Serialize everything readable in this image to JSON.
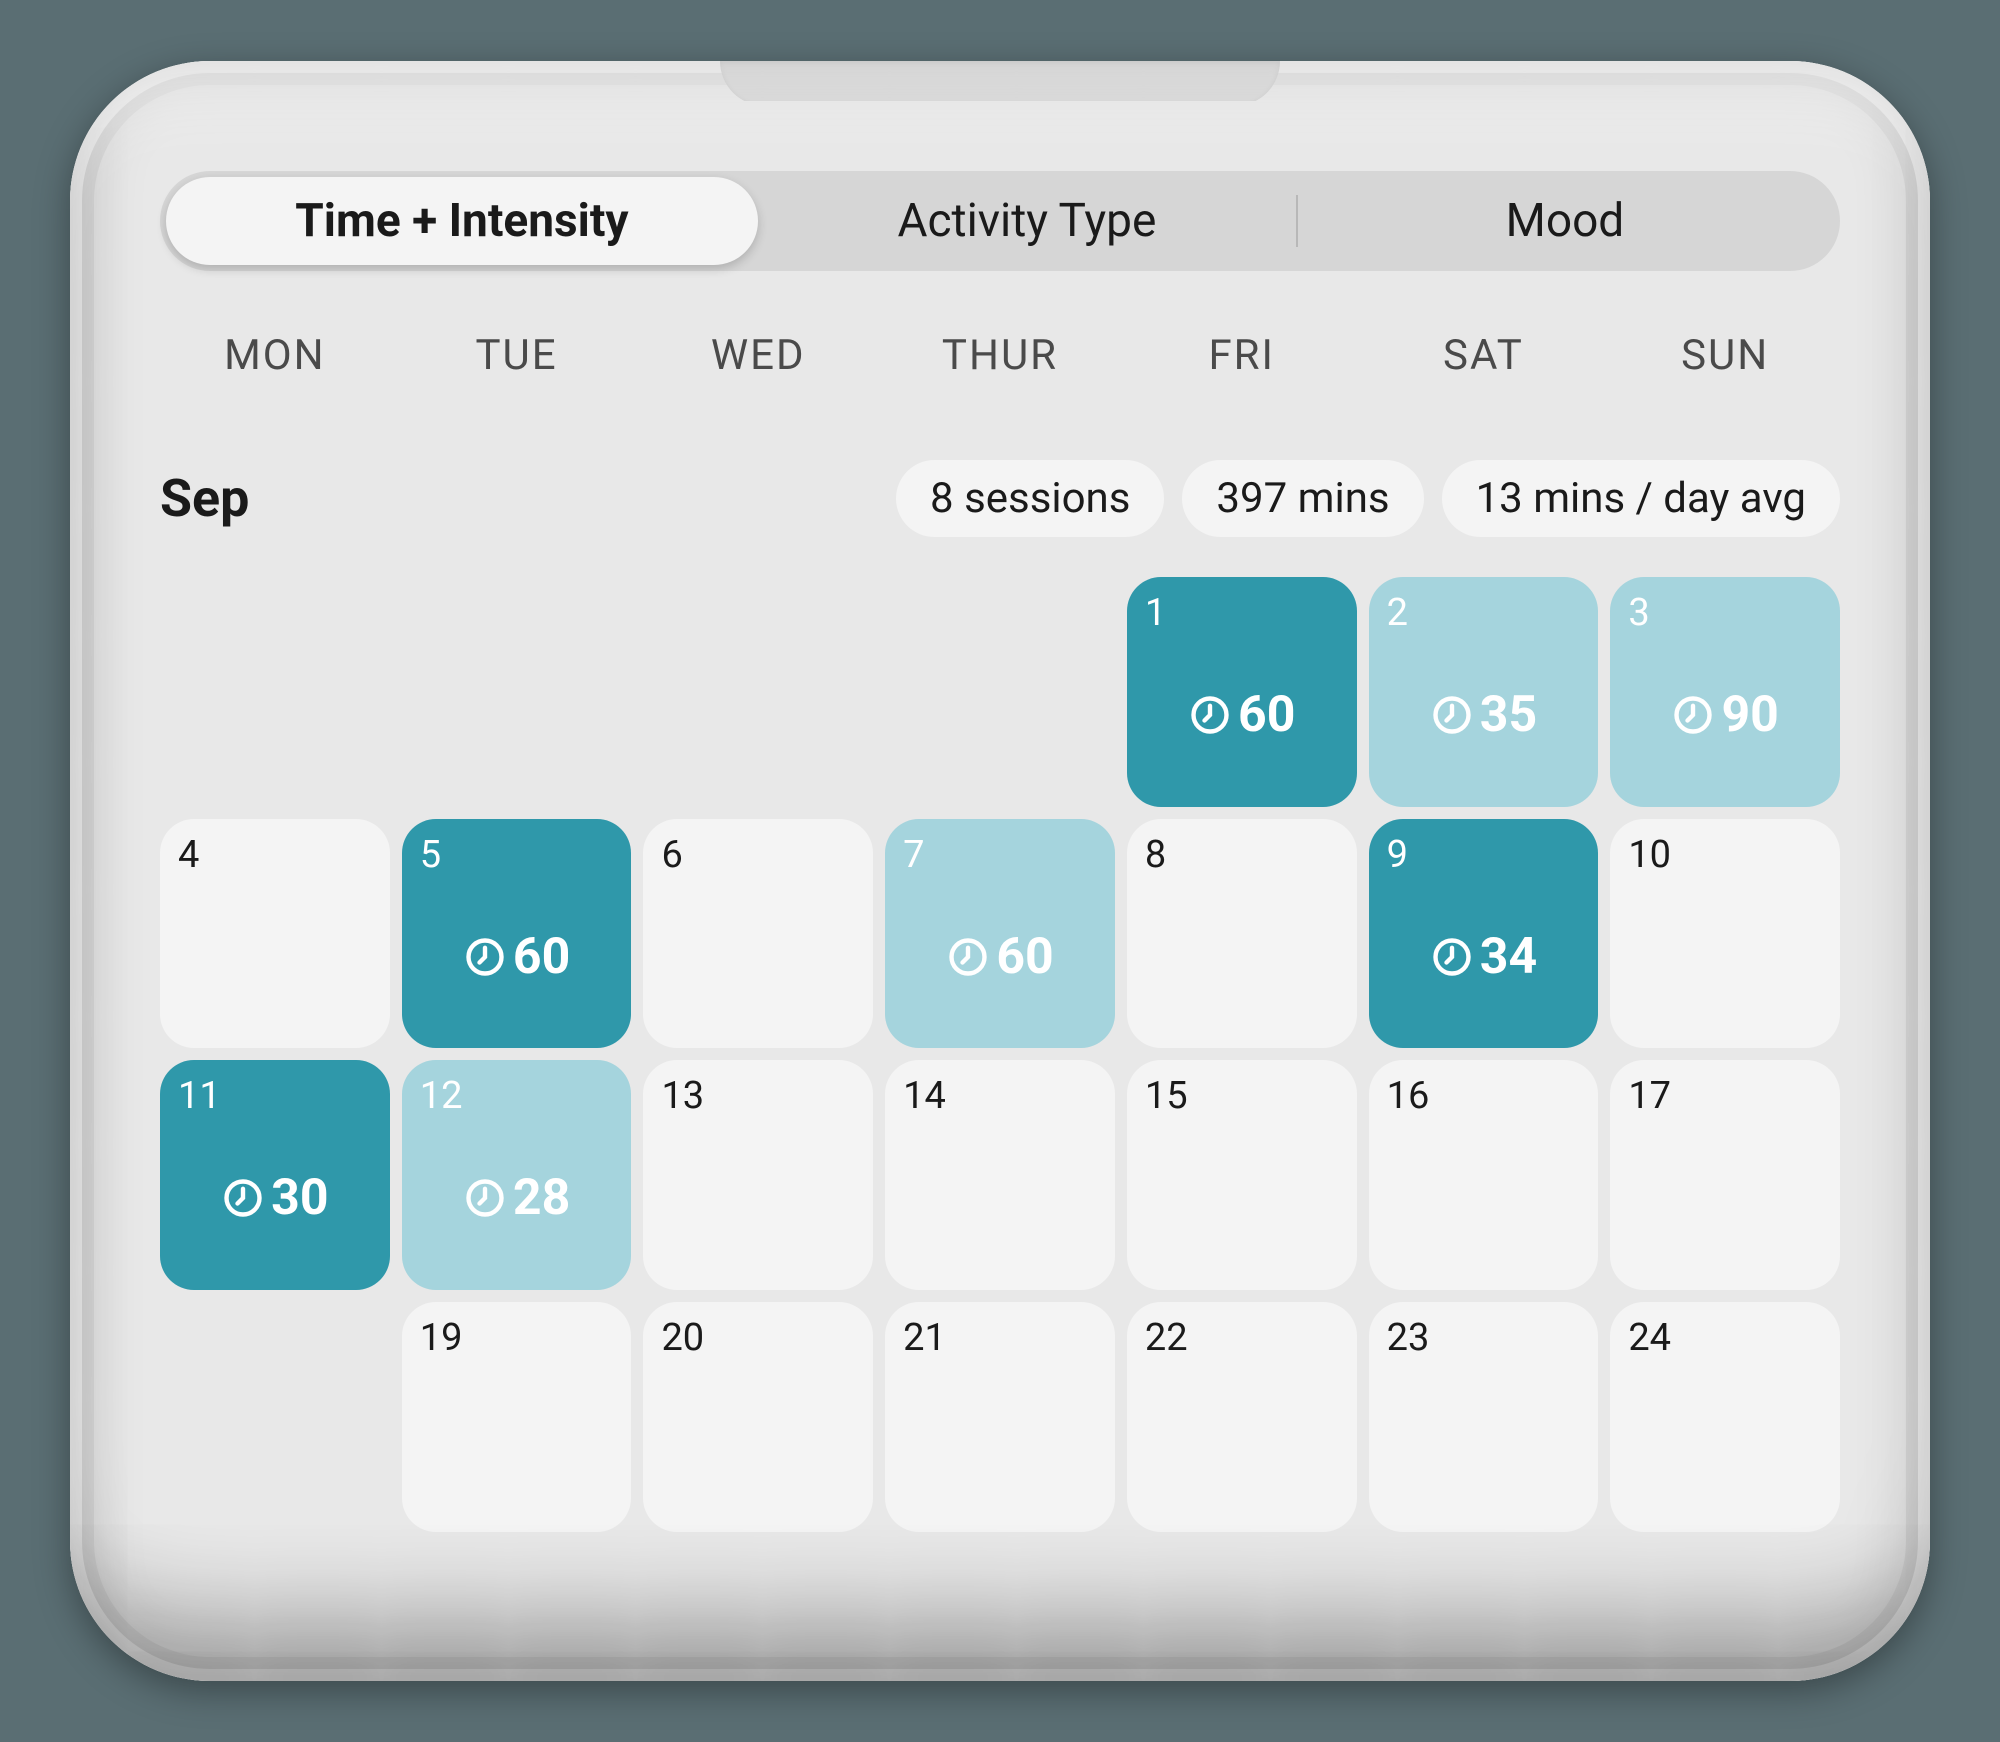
{
  "tabs": [
    {
      "label": "Time + Intensity",
      "active": true
    },
    {
      "label": "Activity Type",
      "active": false
    },
    {
      "label": "Mood",
      "active": false
    }
  ],
  "days_of_week": [
    "MON",
    "TUE",
    "WED",
    "THUR",
    "FRI",
    "SAT",
    "SUN"
  ],
  "month": "Sep",
  "stats": {
    "sessions": "8 sessions",
    "total_mins": "397 mins",
    "daily_avg": "13 mins / day avg"
  },
  "colors": {
    "high": "#2f98aa",
    "low": "#a5d4dd",
    "empty": "#f4f4f4"
  },
  "cells": [
    {
      "blank": true
    },
    {
      "blank": true
    },
    {
      "blank": true
    },
    {
      "blank": true
    },
    {
      "day": 1,
      "mins": 60,
      "intensity": "high"
    },
    {
      "day": 2,
      "mins": 35,
      "intensity": "low"
    },
    {
      "day": 3,
      "mins": 90,
      "intensity": "low"
    },
    {
      "day": 4
    },
    {
      "day": 5,
      "mins": 60,
      "intensity": "high"
    },
    {
      "day": 6
    },
    {
      "day": 7,
      "mins": 60,
      "intensity": "low"
    },
    {
      "day": 8
    },
    {
      "day": 9,
      "mins": 34,
      "intensity": "high"
    },
    {
      "day": 10
    },
    {
      "day": 11,
      "mins": 30,
      "intensity": "high"
    },
    {
      "day": 12,
      "mins": 28,
      "intensity": "low"
    },
    {
      "day": 13
    },
    {
      "day": 14
    },
    {
      "day": 15
    },
    {
      "day": 16
    },
    {
      "day": 17
    },
    {
      "blank": true
    },
    {
      "day": 19
    },
    {
      "day": 20
    },
    {
      "day": 21
    },
    {
      "day": 22
    },
    {
      "day": 23
    },
    {
      "day": 24
    }
  ],
  "chart_data": {
    "type": "table",
    "title": "Sep — Time + Intensity",
    "unit": "mins",
    "series": [
      {
        "name": "minutes",
        "x": [
          1,
          2,
          3,
          5,
          7,
          9,
          11,
          12
        ],
        "values": [
          60,
          35,
          90,
          60,
          60,
          34,
          30,
          28
        ]
      }
    ],
    "summary": {
      "sessions": 8,
      "total_mins": 397,
      "daily_avg_mins": 13
    }
  }
}
